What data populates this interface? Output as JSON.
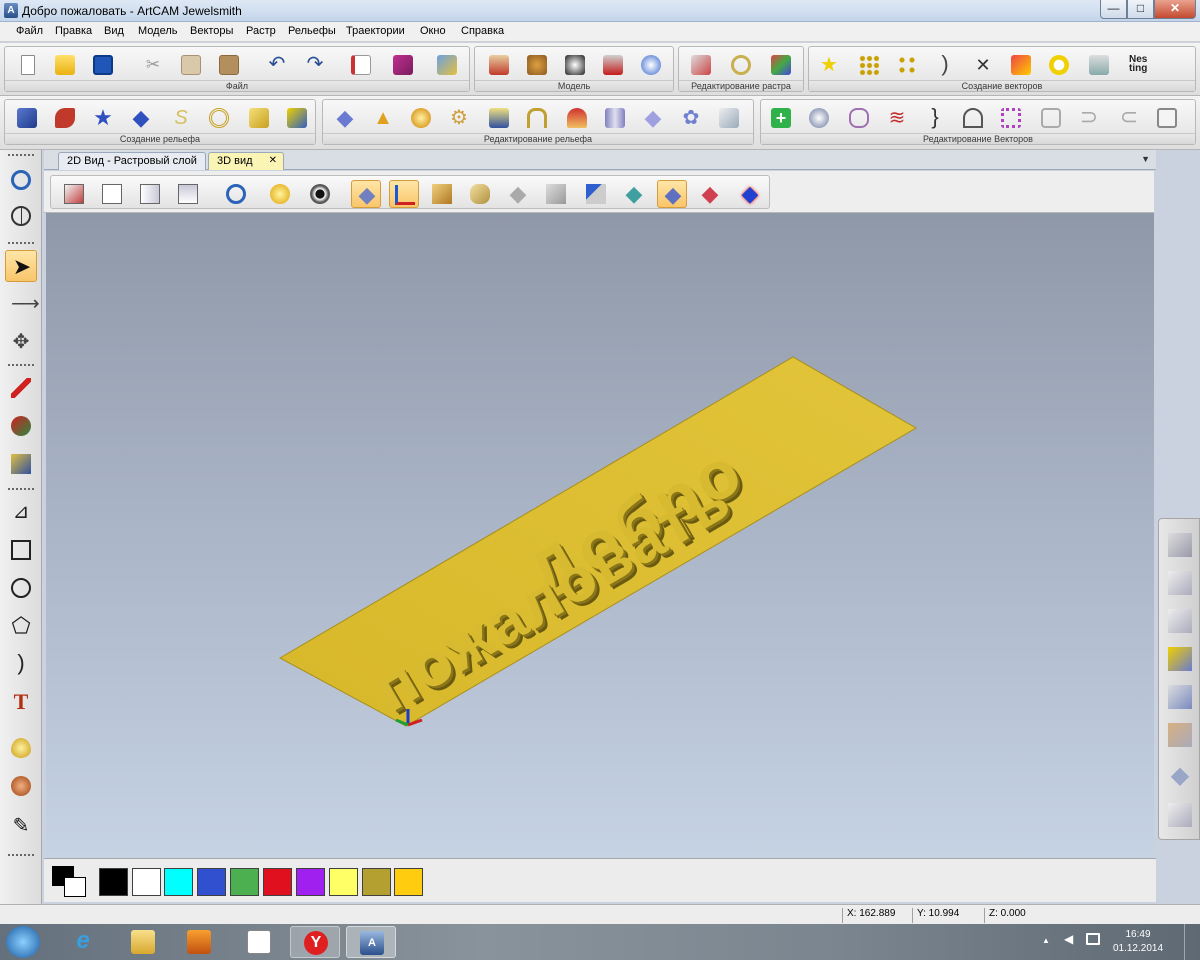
{
  "window": {
    "title": "Добро пожаловать - ArtCAM Jewelsmith",
    "app_icon": "artcam-icon",
    "minimize": "—",
    "maximize": "□",
    "close": "✕"
  },
  "menu": [
    "Файл",
    "Правка",
    "Вид",
    "Модель",
    "Векторы",
    "Растр",
    "Рельефы",
    "Траектории",
    "Окно",
    "Справка"
  ],
  "toolbar1": {
    "groups": [
      {
        "label": "Файл",
        "icons": [
          "new-file-icon",
          "open-folder-icon",
          "save-icon",
          "cut-icon",
          "copy-icon",
          "paste-icon",
          "undo-icon",
          "redo-icon",
          "edit-notes-icon",
          "book-icon",
          "import-icon"
        ]
      },
      {
        "label": "Модель",
        "icons": [
          "model-bear-icon",
          "model-teddy-icon",
          "model-grayscale-icon",
          "model-hat-icon",
          "model-sphere-icon"
        ]
      },
      {
        "label": "Редактирование растра",
        "icons": [
          "raster-fill-icon",
          "raster-ring-icon",
          "raster-paint-icon"
        ]
      },
      {
        "label": "Создание векторов",
        "icons": [
          "star-vector-icon",
          "node-grid-icon",
          "node-path-icon",
          "arc-vector-icon",
          "cross-nodes-icon",
          "curve-pencil-icon",
          "ring-vector-icon",
          "layers-vector-icon",
          "nesting-icon"
        ]
      }
    ],
    "nesting_text": "Nes\nting"
  },
  "toolbar2": {
    "groups": [
      {
        "label": "Создание рельефа",
        "icons": [
          "relief-shapes-icon",
          "relief-leaf-icon",
          "relief-star-icon",
          "relief-sweep-icon",
          "relief-s-icon",
          "relief-knot-icon",
          "relief-plane-icon",
          "relief-wizard-icon"
        ]
      },
      {
        "label": "Редактирование рельефа",
        "icons": [
          "relief-flat-icon",
          "relief-spike-icon",
          "relief-lamp-icon",
          "relief-gears-icon",
          "relief-drip-icon",
          "relief-bag-icon",
          "relief-mushroom-icon",
          "relief-pillar-icon",
          "relief-diamond-icon",
          "relief-flower-icon",
          "relief-pencil-icon"
        ]
      },
      {
        "label": "Редактирование Векторов",
        "icons": [
          "vec-add-icon",
          "vec-cone-icon",
          "vec-mirror-icon",
          "vec-wave-icon",
          "vec-bracket-icon",
          "vec-shape-icon",
          "vec-pink-square-icon",
          "vec-offset-icon",
          "vec-arc-icon",
          "vec-curve-icon",
          "vec-frame-icon"
        ]
      }
    ]
  },
  "tabs": {
    "tab_2d": "2D Вид - Растровый слой",
    "tab_3d": "3D вид",
    "close": "✕",
    "dropdown": "▼"
  },
  "view_toolbar": [
    "iso-view-icon",
    "front-view-icon",
    "side-view-icon",
    "top-view-icon",
    "zoom-icon",
    "light-icon",
    "eye-icon",
    "relief-layer-icon",
    "axes-icon",
    "box-icon",
    "cylinder-icon",
    "plane-gray-icon",
    "wedge-icon",
    "brush-icon",
    "grid-plane-icon",
    "shaded-plane-icon",
    "red-plane-icon",
    "heatmap-icon"
  ],
  "model_text": {
    "line1": "Добро",
    "line2": "пожаловать"
  },
  "colors": {
    "palette": [
      "#000000",
      "#ffffff",
      "#00ffff",
      "#3050d0",
      "#4caf50",
      "#e0101e",
      "#a020f0",
      "#ffff66",
      "#b3a030",
      "#ffcc10"
    ],
    "primary": "#000000",
    "secondary": "#ffffff",
    "relief": "#d8b82a",
    "relief_side": "#7a6a16"
  },
  "left_tools": [
    "zoom-tool-icon",
    "globe-icon",
    "select-arrow-icon",
    "node-edit-icon",
    "transform-icon",
    "pen-icon",
    "paint-roller-icon",
    "box-select-icon",
    "polyline-icon",
    "rectangle-icon",
    "circle-icon",
    "polygon-icon",
    "arc-icon",
    "text-icon",
    "drop-icon",
    "brush-feather-icon",
    "edit-pen-icon"
  ],
  "right_tools": [
    "layers-top-icon",
    "layer-2-icon",
    "layer-3-icon",
    "layer-4-icon",
    "layer-5-icon",
    "layer-6-icon",
    "layer-7-icon",
    "layer-8-icon"
  ],
  "status": {
    "x": "X: 162.889",
    "y": "Y: 10.994",
    "z": "Z: 0.000"
  },
  "taskbar": {
    "apps": [
      "start-orb-icon",
      "ie-icon",
      "explorer-icon",
      "media-player-icon",
      "document-icon",
      "yandex-icon",
      "artcam-icon"
    ],
    "time": "16:49",
    "date": "01.12.2014",
    "tray_arrow": "▲"
  }
}
